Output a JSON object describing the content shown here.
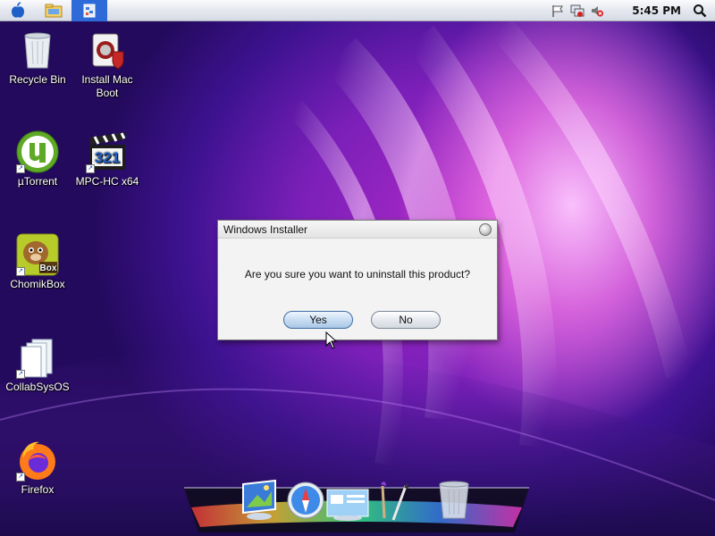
{
  "menubar": {
    "clock": "5:45 PM",
    "left_icons": [
      "apple-icon",
      "folder-icon",
      "control-panel-icon"
    ],
    "tray_icons": [
      "flag-icon",
      "network-icon",
      "volume-muted-icon"
    ],
    "search_icon": "magnifier-icon",
    "active_color": "#2e6bd8"
  },
  "desktop": {
    "icons": [
      {
        "label": "Recycle Bin"
      },
      {
        "label": "Install Mac Boot"
      },
      {
        "label": "µTorrent"
      },
      {
        "label": "MPC-HC x64"
      },
      {
        "label": "ChomikBox"
      },
      {
        "label": "CollabSysOS"
      },
      {
        "label": "Firefox"
      }
    ],
    "mpc_badge": "321",
    "chomik_badge": "Box"
  },
  "dialog": {
    "title": "Windows Installer",
    "message": "Are you sure you want to uninstall this product?",
    "yes_label": "Yes",
    "no_label": "No"
  },
  "dock": {
    "items": [
      "picture-viewer-icon",
      "safari-compass-icon",
      "finder-window-icon",
      "paint-brush-icon",
      "trash-icon"
    ]
  }
}
